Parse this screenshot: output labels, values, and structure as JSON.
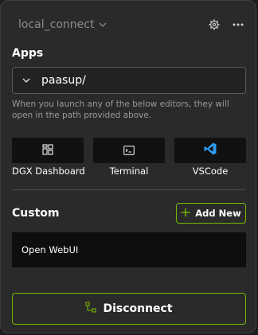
{
  "header": {
    "connection_name": "local_connect",
    "icons": [
      "chevron-down-icon",
      "gear-icon",
      "more-options-icon"
    ]
  },
  "apps": {
    "title": "Apps",
    "path_value": "paasup/",
    "hint": "When you launch any of the below editors, they will open in the path provided above.",
    "items": [
      {
        "label": "DGX Dashboard",
        "icon": "dashboard-grid-icon"
      },
      {
        "label": "Terminal",
        "icon": "terminal-icon"
      },
      {
        "label": "VSCode",
        "icon": "vscode-icon"
      }
    ]
  },
  "custom": {
    "title": "Custom",
    "add_label": "Add New",
    "items": [
      {
        "label": "Open WebUI"
      }
    ]
  },
  "footer": {
    "disconnect_label": "Disconnect"
  },
  "colors": {
    "accent": "#76b900",
    "vscode_blue": "#2f9bf0",
    "panel_bg": "#2a2a2a"
  }
}
